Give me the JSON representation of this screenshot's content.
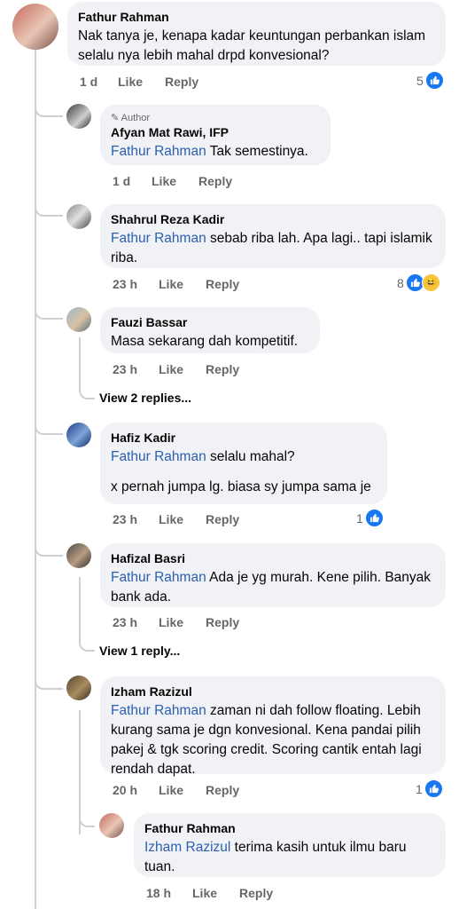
{
  "comments": [
    {
      "name": "Fathur Rahman",
      "text": "Nak tanya je, kenapa kadar keuntungan perbankan islam selalu nya lebih mahal drpd konvesional?",
      "time": "1 d",
      "like": "Like",
      "reply": "Reply",
      "reactions": "5"
    },
    {
      "badge": "Author",
      "name": "Afyan Mat Rawi, IFP",
      "mention": "Fathur Rahman",
      "text": "Tak semestinya.",
      "time": "1 d",
      "like": "Like",
      "reply": "Reply"
    },
    {
      "name": "Shahrul Reza Kadir",
      "mention": "Fathur Rahman",
      "text": "sebab riba lah. Apa lagi.. tapi islamik riba.",
      "time": "23 h",
      "like": "Like",
      "reply": "Reply",
      "reactions": "8"
    },
    {
      "name": "Fauzi Bassar",
      "text": "Masa sekarang dah kompetitif.",
      "time": "23 h",
      "like": "Like",
      "reply": "Reply",
      "view_replies": "View 2 replies..."
    },
    {
      "name": "Hafiz Kadir",
      "mention": "Fathur Rahman",
      "text": "selalu mahal?",
      "text2": "x pernah jumpa lg. biasa sy jumpa sama je",
      "time": "23 h",
      "like": "Like",
      "reply": "Reply",
      "reactions": "1"
    },
    {
      "name": "Hafizal Basri",
      "mention": "Fathur Rahman",
      "text": "Ada je yg murah. Kene pilih. Banyak bank ada.",
      "time": "23 h",
      "like": "Like",
      "reply": "Reply",
      "view_replies": "View 1 reply..."
    },
    {
      "name": "Izham Razizul",
      "mention": "Fathur Rahman",
      "text": "zaman ni dah follow floating. Lebih kurang sama je dgn konvesional. Kena pandai pilih pakej & tgk scoring credit. Scoring cantik entah lagi rendah dapat.",
      "time": "20 h",
      "like": "Like",
      "reply": "Reply",
      "reactions": "1"
    },
    {
      "name": "Fathur Rahman",
      "mention": "Izham Razizul",
      "text": "terima kasih untuk ilmu baru tuan.",
      "time": "18 h",
      "like": "Like",
      "reply": "Reply"
    }
  ],
  "colors": {
    "bubble": "#f0f2f5",
    "mention": "#2b5fb0",
    "like": "#1877f2",
    "meta": "#65676b"
  }
}
